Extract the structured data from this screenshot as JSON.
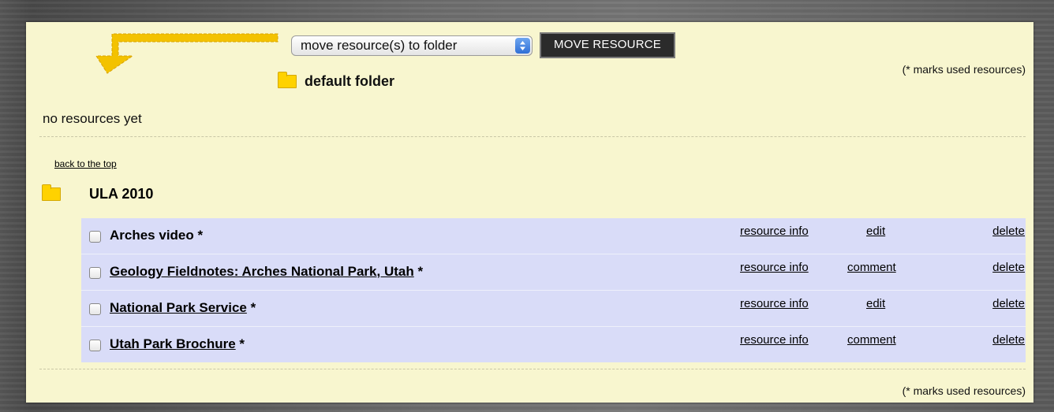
{
  "toolbar": {
    "select_value": "move resource(s) to folder",
    "move_button_label": "MOVE RESOURCE",
    "target_folder_label": "default folder",
    "marks_note": "(* marks used resources)"
  },
  "default_folder": {
    "empty_text": "no resources yet"
  },
  "back_to_top": "back to the top",
  "folder": {
    "name": "ULA 2010",
    "resources": [
      {
        "title": "Arches video",
        "marker": "*",
        "info_label": "resource info",
        "action_label": "edit",
        "delete_label": "delete"
      },
      {
        "title": "Geology Fieldnotes: Arches National Park, Utah",
        "marker": "*",
        "info_label": "resource info",
        "action_label": "comment",
        "delete_label": "delete"
      },
      {
        "title": "National Park Service",
        "marker": "*",
        "info_label": "resource info",
        "action_label": "edit",
        "delete_label": "delete"
      },
      {
        "title": "Utah Park Brochure",
        "marker": "*",
        "info_label": "resource info",
        "action_label": "comment",
        "delete_label": "delete"
      }
    ]
  },
  "footer": {
    "marks_note": "(* marks used resources)"
  },
  "colors": {
    "panel_bg": "#f8f6cf",
    "row_bg": "#d9dcf8",
    "folder_icon": "#ffd200",
    "arrow": "#f3c200",
    "button_bg": "#2b2b2b"
  }
}
